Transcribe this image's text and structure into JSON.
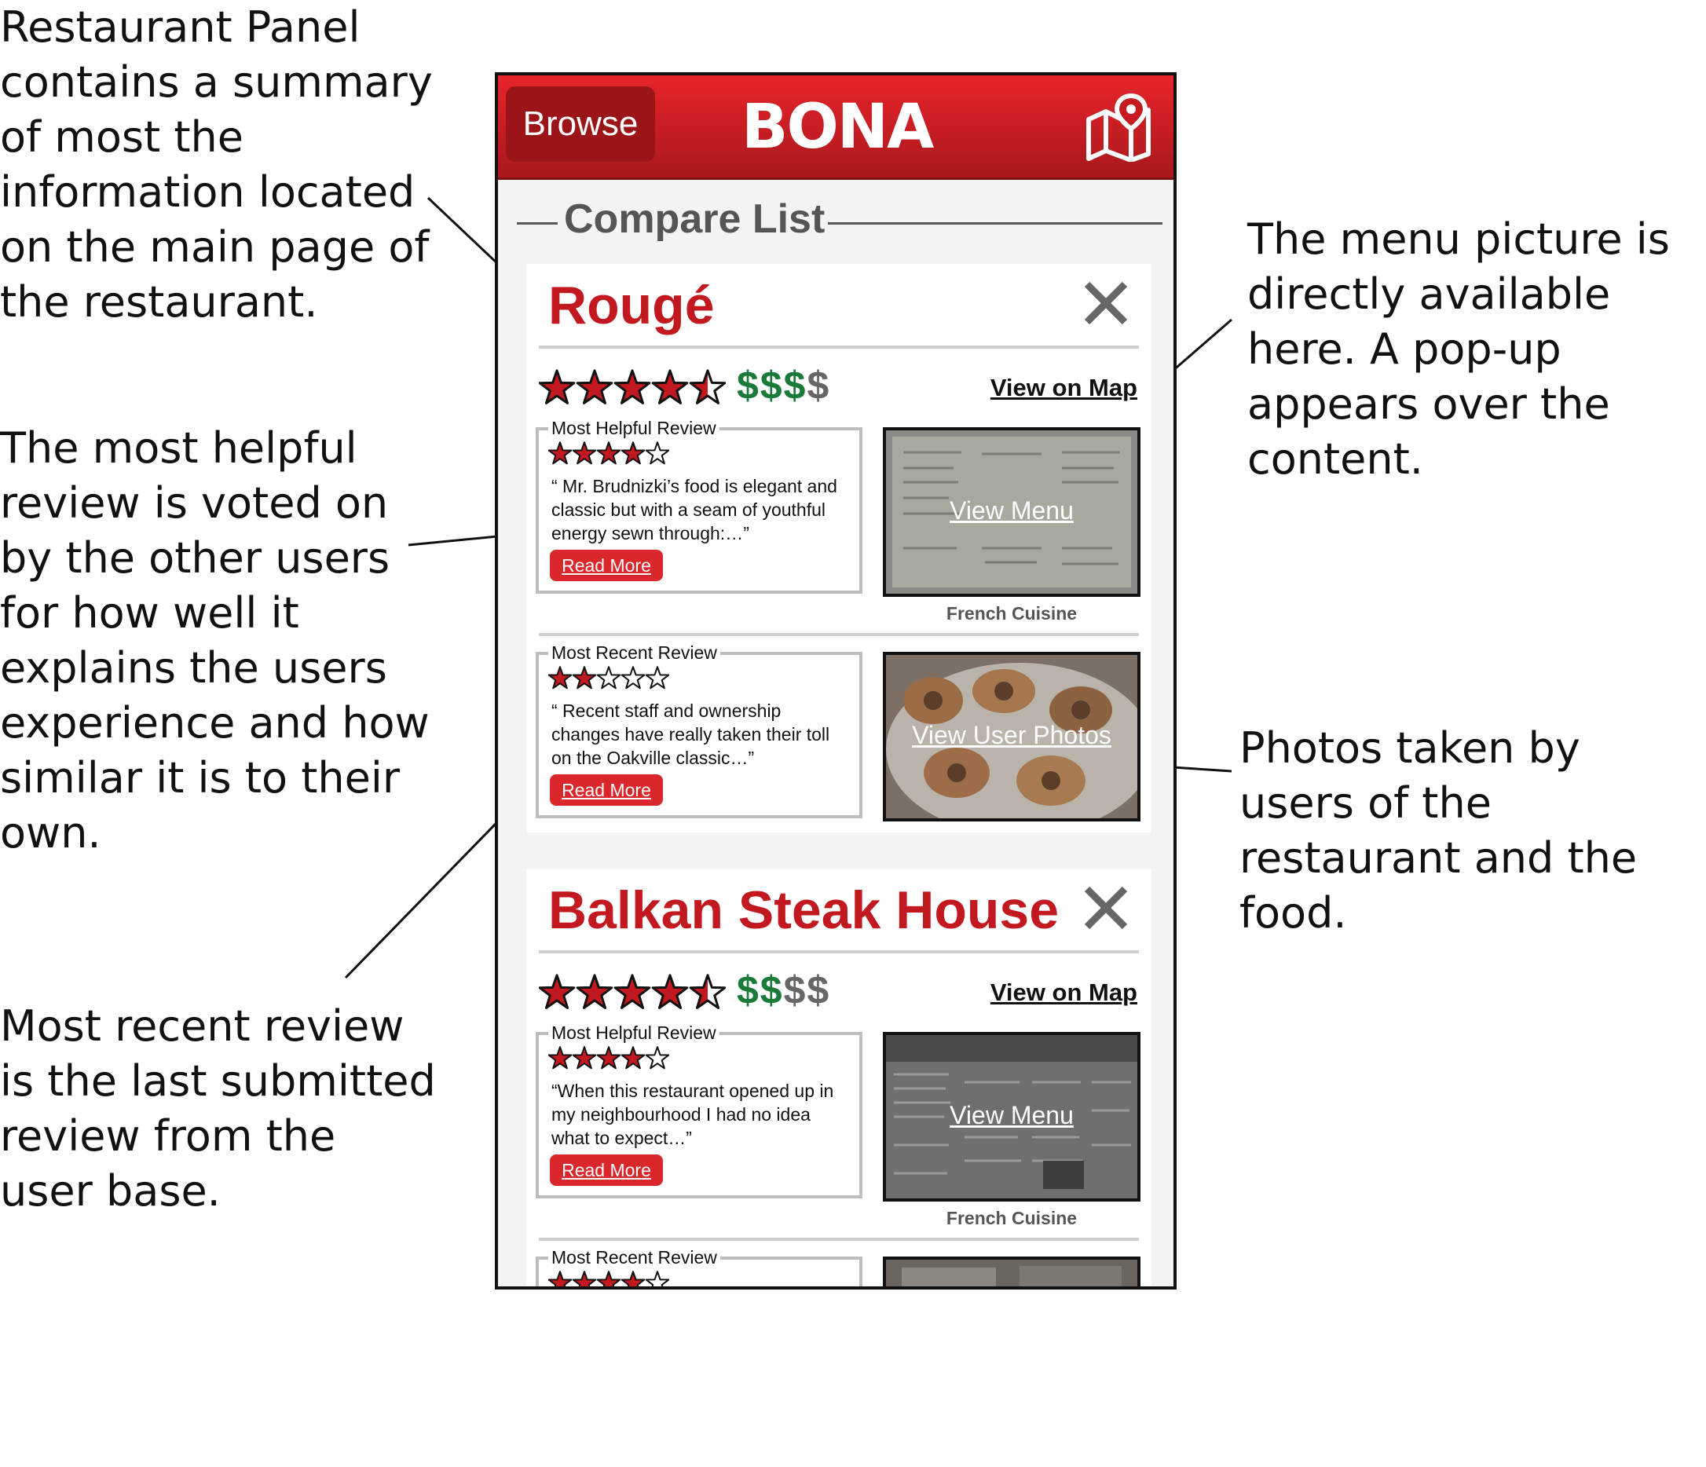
{
  "annotations": {
    "panel": "Restaurant Panel contains a summary of most the information located on the main page of the restaurant.",
    "helpful": "The most helpful review is voted on by the other users for how well it explains the users experience and how similar it is to their own.",
    "recent": "Most recent review is the last submitted review from the user base.",
    "menu": "The menu picture is directly available here. A pop-up appears over the content.",
    "photos": "Photos taken by users of the restaurant and the food."
  },
  "app": {
    "browse_label": "Browse",
    "logo": "BONA",
    "section_title": "Compare List",
    "accent_color": "#c1191f"
  },
  "restaurants": [
    {
      "name": "Rougé",
      "rating": 4.5,
      "price": {
        "on": "$$$",
        "off": "$"
      },
      "map_link": "View on Map",
      "helpful": {
        "label": "Most Helpful Review",
        "rating": 4,
        "text": "“ Mr. Brudnizki’s food is elegant and classic but with a seam of youthful energy sewn through:…”",
        "read_more": "Read More"
      },
      "menu_link": "View Menu",
      "cuisine": "French Cuisine",
      "recent": {
        "label": "Most Recent Review",
        "rating": 2,
        "text": "“ Recent staff and ownership changes have really taken their toll on the Oakville classic…”",
        "read_more": "Read More"
      },
      "photos_link": "View User Photos"
    },
    {
      "name": "Balkan Steak House",
      "rating": 4.5,
      "price": {
        "on": "$$",
        "off": "$$"
      },
      "map_link": "View on Map",
      "helpful": {
        "label": "Most Helpful Review",
        "rating": 4,
        "text": "“When this restaurant opened up in my neighbourhood I had no idea what to expect…”",
        "read_more": "Read More"
      },
      "menu_link": "View Menu",
      "cuisine": "French Cuisine",
      "recent": {
        "label": "Most Recent Review",
        "rating": 4
      }
    }
  ]
}
